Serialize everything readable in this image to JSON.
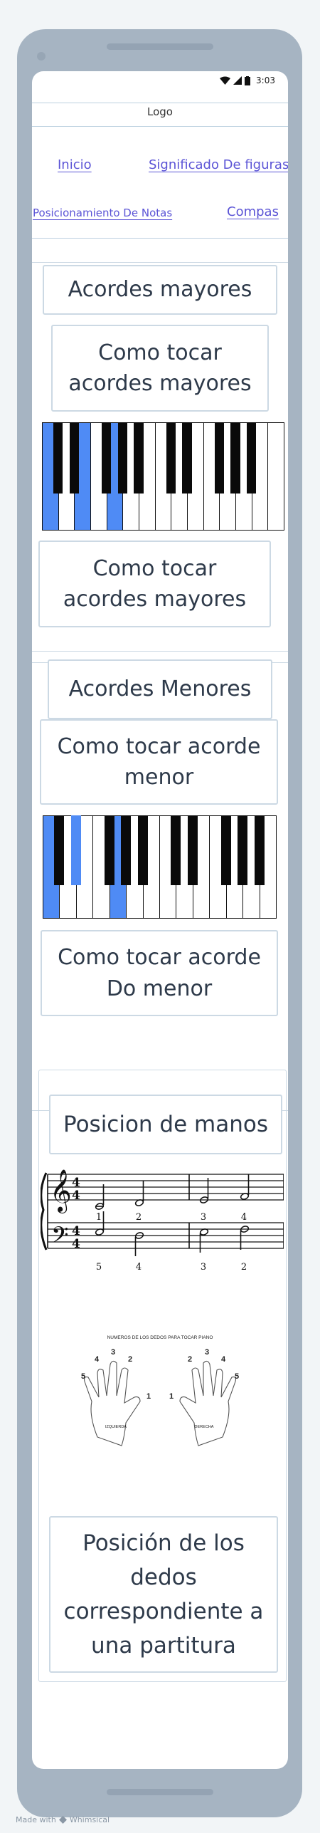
{
  "status_bar": {
    "time": "3:03"
  },
  "header": {
    "logo": "Logo"
  },
  "nav": {
    "inicio": "Inicio",
    "significado": "Significado De figuras",
    "posicionamiento": "Posicionamiento De Notas",
    "compas": "Compas"
  },
  "mayores": {
    "title": "Acordes mayores",
    "how_to_1": "Como tocar acordes mayores",
    "how_to_2": "Como tocar acordes mayores",
    "piano_highlight_colour": "#4f8bf5"
  },
  "menores": {
    "title": "Acordes Menores",
    "how_to_1": "Como tocar acorde menor",
    "how_to_2": "Como tocar acorde Do menor"
  },
  "manos": {
    "title": "Posicion de manos",
    "sheet": {
      "treble_time_top": "4",
      "treble_time_bottom": "4",
      "bass_time_top": "4",
      "bass_time_bottom": "4",
      "treble_fingers": [
        "1",
        "2",
        "3",
        "4"
      ],
      "bass_fingers": [
        "5",
        "4",
        "3",
        "2"
      ]
    },
    "hands": {
      "title": "NUMEROS DE LOS DEDOS PARA TOCAR PIANO",
      "left_label": "IZQUIERDA",
      "right_label": "DERECHA",
      "left_fingers": [
        "5",
        "4",
        "3",
        "2",
        "1"
      ],
      "right_fingers": [
        "1",
        "2",
        "3",
        "4",
        "5"
      ]
    },
    "caption": "Posición de los dedos correspondiente a una partitura"
  },
  "footer": {
    "made_with": "Made with",
    "brand": "Whimsical"
  }
}
